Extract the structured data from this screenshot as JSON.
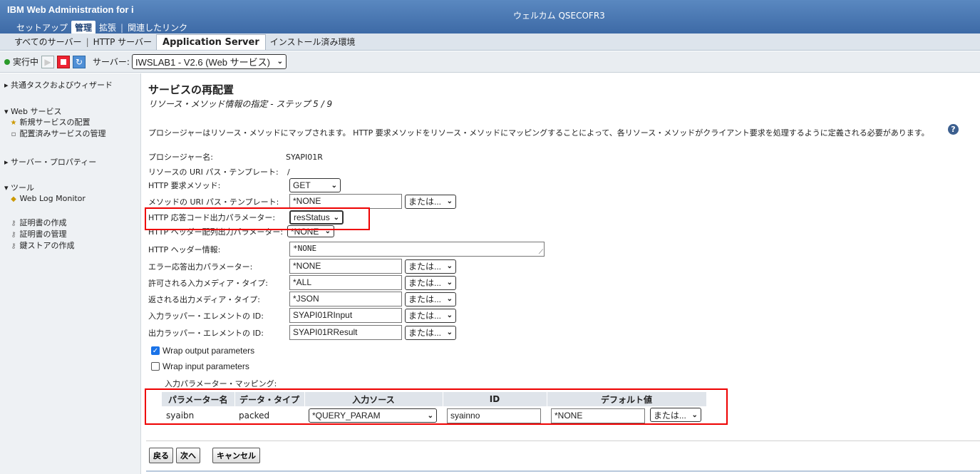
{
  "header": {
    "app_title": "IBM Web Administration for i",
    "welcome": "ウェルカム QSECOFR3",
    "tabs": [
      {
        "label": "セットアップ"
      },
      {
        "label": "管理"
      },
      {
        "label": "拡張"
      },
      {
        "label": "関連したリンク"
      }
    ]
  },
  "subtabs": [
    {
      "label": "すべてのサーバー"
    },
    {
      "label": "HTTP サーバー"
    },
    {
      "label": "Application Server"
    },
    {
      "label": "インストール済み環境"
    }
  ],
  "serverbar": {
    "status": "実行中",
    "server_label": "サーバー:",
    "server_value": "IWSLAB1 - V2.6 (Web サービス)"
  },
  "sidebar": {
    "common_tasks": "共通タスクおよびウィザード",
    "web_services": "Web サービス",
    "deploy_new": "新規サービスの配置",
    "manage_deployed": "配置済みサービスの管理",
    "server_properties": "サーバー・プロパティー",
    "tools": "ツール",
    "web_log_monitor": "Web Log Monitor",
    "create_cert": "証明書の作成",
    "manage_cert": "証明書の管理",
    "create_keystore": "鍵ストアの作成"
  },
  "main": {
    "title": "サービスの再配置",
    "step": "リソース・メソッド情報の指定 - ステップ 5 / 9",
    "description": "プロシージャーはリソース・メソッドにマップされます。 HTTP 要求メソッドをリソース・メソッドにマッピングすることによって、各リソース・メソッドがクライアント要求を処理するように定義される必要があります。",
    "or_label": "または...",
    "fields": {
      "procedure_name_label": "プロシージャー名:",
      "procedure_name": "SYAPI01R",
      "resource_uri_label": "リソースの URI パス・テンプレート:",
      "resource_uri": "/",
      "http_method_label": "HTTP 要求メソッド:",
      "http_method": "GET",
      "method_uri_label": "メソッドの URI パス・テンプレート:",
      "method_uri": "*NONE",
      "resp_code_label": "HTTP 応答コード出力パラメーター:",
      "resp_code": "resStatus",
      "header_array_label": "HTTP ヘッダー配列出力パラメーター:",
      "header_array": "*NONE",
      "header_info_label": "HTTP ヘッダー情報:",
      "header_info": "*NONE",
      "error_resp_label": "エラー応答出力パラメーター:",
      "error_resp": "*NONE",
      "input_media_label": "許可される入力メディア・タイプ:",
      "input_media": "*ALL",
      "output_media_label": "返される出力メディア・タイプ:",
      "output_media": "*JSON",
      "input_wrapper_label": "入力ラッパー・エレメントの ID:",
      "input_wrapper": "SYAPI01RInput",
      "output_wrapper_label": "出力ラッパー・エレメントの ID:",
      "output_wrapper": "SYAPI01RResult"
    },
    "wrap_output": "Wrap output parameters",
    "wrap_input": "Wrap input parameters",
    "mapping_label": "入力パラメーター・マッピング:",
    "mapping_table": {
      "headers": [
        "パラメーター名",
        "データ・タイプ",
        "入力ソース",
        "ID",
        "デフォルト値"
      ],
      "rows": [
        {
          "name": "syaibn",
          "type": "packed",
          "source": "*QUERY_PARAM",
          "id": "syainno",
          "default": "*NONE"
        }
      ]
    },
    "buttons": {
      "back": "戻る",
      "next": "次へ",
      "cancel": "キャンセル"
    }
  }
}
